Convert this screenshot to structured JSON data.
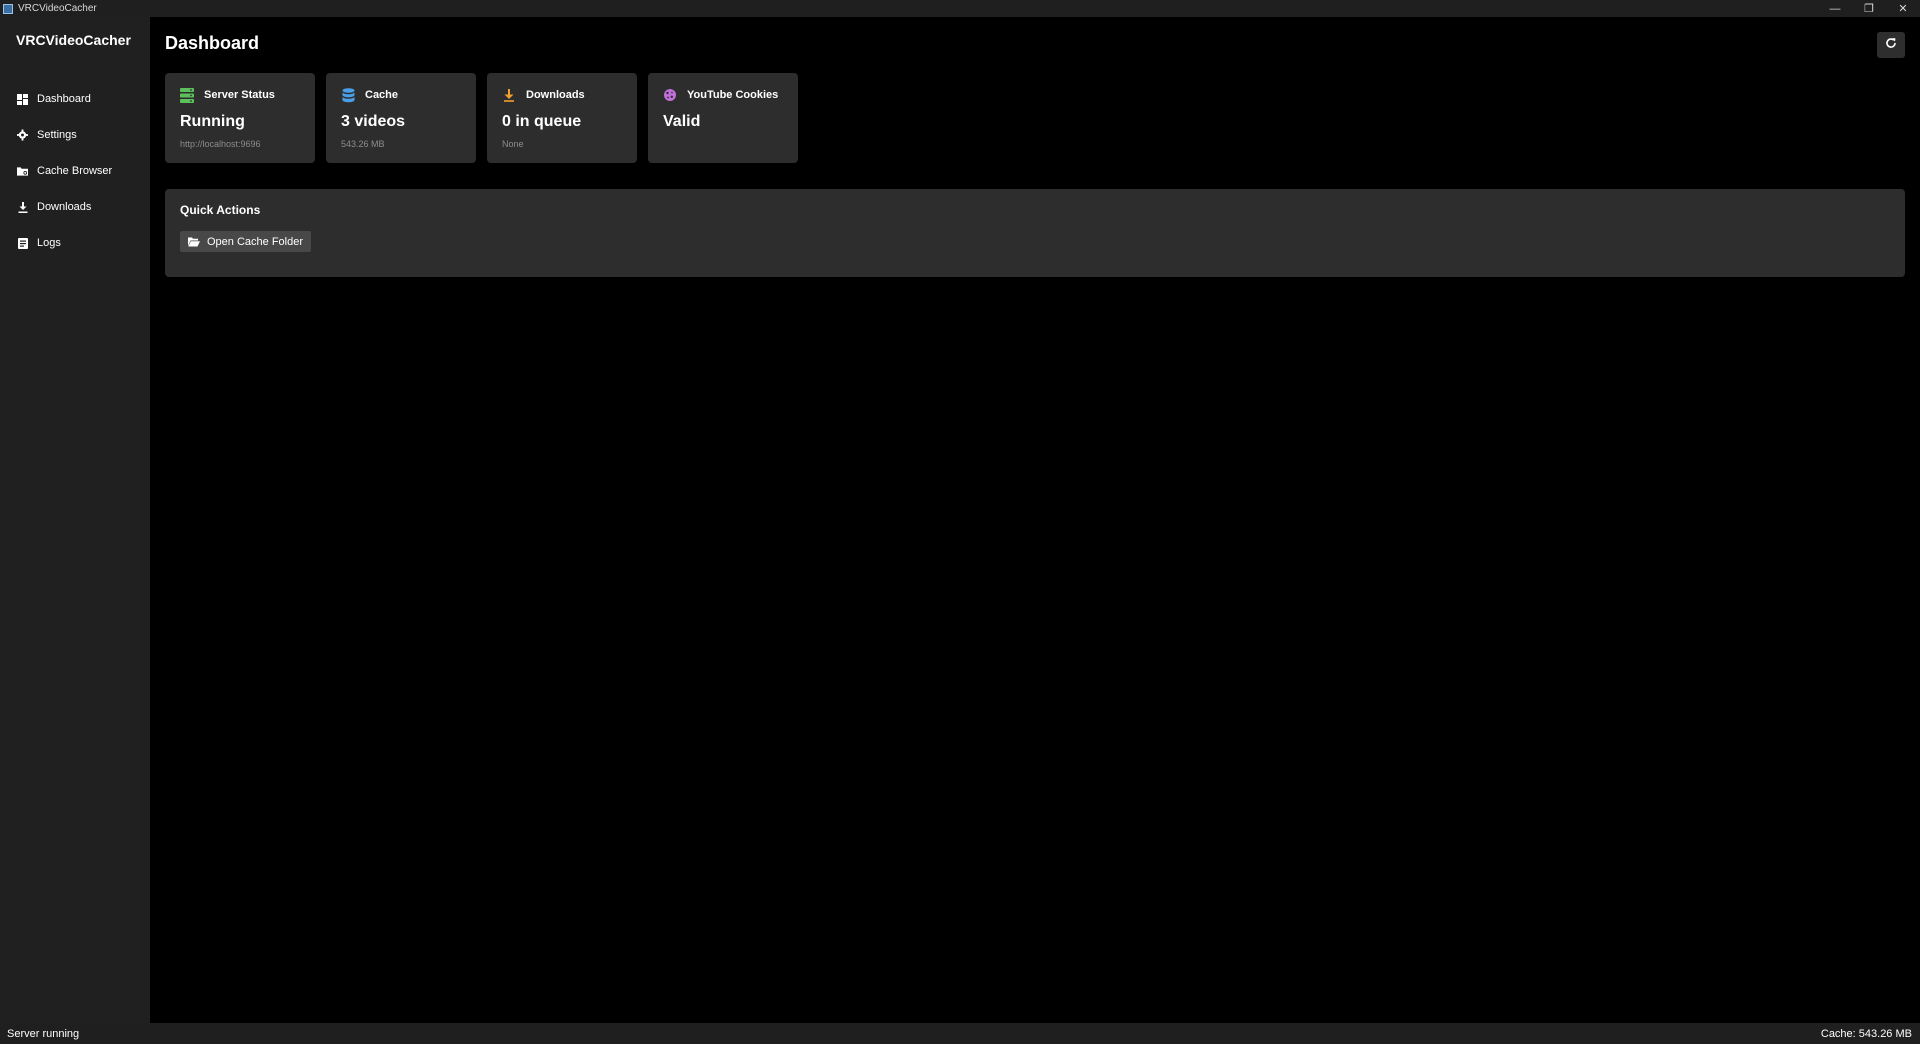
{
  "window": {
    "title": "VRCVideoCacher",
    "controls": {
      "minimize": "—",
      "restore": "❐",
      "close": "✕"
    }
  },
  "sidebar": {
    "brand": "VRCVideoCacher",
    "items": [
      {
        "label": "Dashboard",
        "icon": "dashboard-icon"
      },
      {
        "label": "Settings",
        "icon": "gear-icon"
      },
      {
        "label": "Cache Browser",
        "icon": "folder-icon"
      },
      {
        "label": "Downloads",
        "icon": "download-icon"
      },
      {
        "label": "Logs",
        "icon": "log-icon"
      }
    ]
  },
  "main": {
    "title": "Dashboard",
    "refresh_icon": "refresh-icon",
    "cards": [
      {
        "label": "Server Status",
        "value": "Running",
        "sub": "http://localhost:9696",
        "icon": "server-icon",
        "color": "#5cc05c"
      },
      {
        "label": "Cache",
        "value": "3 videos",
        "sub": "543.26 MB",
        "icon": "database-icon",
        "color": "#4a9fe8"
      },
      {
        "label": "Downloads",
        "value": "0 in queue",
        "sub": "None",
        "icon": "download-icon",
        "color": "#f0a030"
      },
      {
        "label": "YouTube Cookies",
        "value": "Valid",
        "sub": "",
        "icon": "cookie-icon",
        "color": "#c070d8"
      }
    ],
    "quick_actions": {
      "title": "Quick Actions",
      "open_cache_folder": "Open Cache Folder"
    }
  },
  "status": {
    "left": "Server running",
    "right": "Cache: 543.26 MB"
  }
}
